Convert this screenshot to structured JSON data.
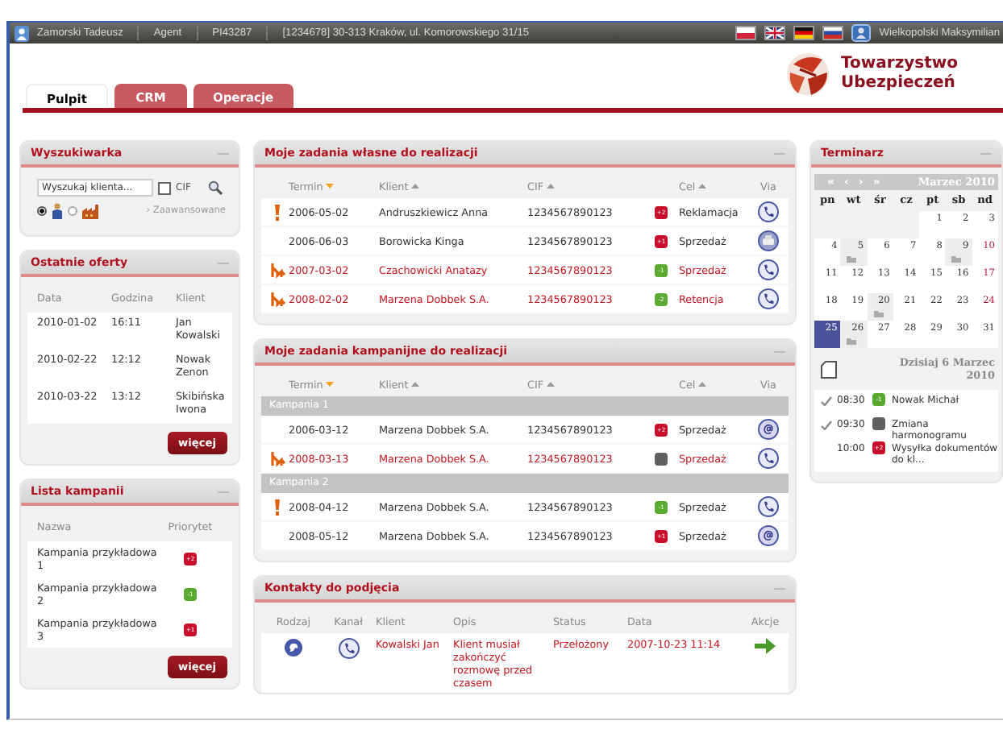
{
  "top_bar": {
    "user": "Zamorski Tadeusz",
    "role": "Agent",
    "agent_id": "PI43287",
    "address": "[1234678] 30-313 Kraków, ul. Komorowskiego 31/15",
    "languages": [
      {
        "kind": "pl"
      },
      {
        "kind": "gb"
      },
      {
        "kind": "de"
      },
      {
        "kind": "ru"
      }
    ],
    "contact": "Wielkopolski Maksymilian"
  },
  "tabs": [
    {
      "label": "Pulpit",
      "selected": true
    },
    {
      "label": "CRM",
      "selected": false
    },
    {
      "label": "Operacje",
      "selected": false
    }
  ],
  "logo": {
    "line1": "Towarzystwo",
    "line2": "Ubezpieczeń"
  },
  "search": {
    "title": "Wyszukiwarka",
    "placeholder": "Wyszukaj klienta...",
    "cif_label": "CIF",
    "cif_checked": false,
    "person_selected": true,
    "company_selected": false,
    "advanced_link": "› Zaawansowane"
  },
  "offers": {
    "title": "Ostatnie oferty",
    "columns": [
      "Data",
      "Godzina",
      "Klient"
    ],
    "rows": [
      [
        "2010-01-02",
        "16:11",
        "Jan Kowalski"
      ],
      [
        "2010-02-22",
        "12:12",
        "Nowak Zenon"
      ],
      [
        "2010-03-22",
        "13:12",
        "Skibińska Iwona"
      ]
    ],
    "button": "więcej"
  },
  "campaigns": {
    "title": "Lista kampanii",
    "columns": [
      "Nazwa",
      "Priorytet"
    ],
    "rows": [
      {
        "name": "Kampania przykładowa 1",
        "priority": "+2",
        "color": "#c8102e"
      },
      {
        "name": "Kampania przykładowa 2",
        "priority": "-1",
        "color": "#5aaa32"
      },
      {
        "name": "Kampania przykładowa 3",
        "priority": "+1",
        "color": "#c8102e"
      }
    ],
    "button": "więcej"
  },
  "own_tasks": {
    "title": "Moje zadania własne do realizacji",
    "columns": [
      {
        "label": "Termin",
        "sort": {
          "kind": "desc"
        }
      },
      {
        "label": "Klient",
        "sort": {
          "kind": "asc"
        }
      },
      {
        "label": "CIF",
        "sort": {
          "kind": "asc"
        }
      },
      {
        "label": "Cel",
        "sort": {
          "kind": "asc"
        }
      },
      {
        "label": "Via"
      }
    ],
    "rows": [
      {
        "alert": {
          "kind": "exclamation"
        },
        "date": "2006-05-02",
        "client": "Andruszkiewicz Anna",
        "cif": "1234567890123",
        "priority": "+2",
        "color": "#c8102e",
        "goal": "Reklamacja",
        "via": {
          "kind": "phone"
        },
        "highlighted": false
      },
      {
        "date": "2006-06-03",
        "client": "Borowicka Kinga",
        "cif": "1234567890123",
        "priority": "+1",
        "color": "#c8102e",
        "goal": "Sprzedaż",
        "via": {
          "kind": "fax"
        },
        "highlighted": false
      },
      {
        "alert": {
          "kind": "escalation"
        },
        "date": "2007-03-02",
        "client": "Czachowicki Anatazy",
        "cif": "1234567890123",
        "priority": "-1",
        "color": "#5aaa32",
        "goal": "Sprzedaż",
        "via": {
          "kind": "phone"
        },
        "highlighted": true
      },
      {
        "alert": {
          "kind": "escalation"
        },
        "date": "2008-02-02",
        "client": "Marzena Dobbek S.A.",
        "cif": "1234567890123",
        "priority": "-2",
        "color": "#5aaa32",
        "goal": "Retencja",
        "via": {
          "kind": "phone"
        },
        "highlighted": true
      }
    ]
  },
  "campaign_tasks": {
    "title": "Moje zadania kampanijne do realizacji",
    "columns": [
      {
        "label": "Termin",
        "sort": {
          "kind": "desc"
        }
      },
      {
        "label": "Klient",
        "sort": {
          "kind": "asc"
        }
      },
      {
        "label": "CIF",
        "sort": {
          "kind": "asc"
        }
      },
      {
        "label": "Cel",
        "sort": {
          "kind": "asc"
        }
      },
      {
        "label": "Via"
      }
    ],
    "groups": [
      {
        "name": "Kampania 1",
        "rows": [
          {
            "date": "2006-03-12",
            "client": "Marzena Dobbek S.A.",
            "cif": "1234567890123",
            "priority": "+2",
            "color": "#c8102e",
            "goal": "Sprzedaż",
            "via": {
              "kind": "email"
            },
            "highlighted": false
          },
          {
            "alert": {
              "kind": "escalation"
            },
            "date": "2008-03-13",
            "client": "Marzena Dobbek S.A.",
            "cif": "1234567890123",
            "color": "#606060",
            "goal": "Sprzedaż",
            "via": {
              "kind": "phone"
            },
            "highlighted": true
          }
        ]
      },
      {
        "name": "Kampania 2",
        "rows": [
          {
            "alert": {
              "kind": "exclamation"
            },
            "date": "2008-04-12",
            "client": "Marzena Dobbek S.A.",
            "cif": "1234567890123",
            "priority": "-1",
            "color": "#5aaa32",
            "goal": "Sprzedaż",
            "via": {
              "kind": "phone"
            },
            "highlighted": false
          },
          {
            "date": "2008-05-12",
            "client": "Marzena Dobbek S.A.",
            "cif": "1234567890123",
            "priority": "+1",
            "color": "#c8102e",
            "goal": "Sprzedaż",
            "via": {
              "kind": "email"
            },
            "highlighted": false
          }
        ]
      }
    ]
  },
  "contacts": {
    "title": "Kontakty do podjęcia",
    "columns": [
      "Rodzaj",
      "Kanał",
      "Klient",
      "Opis",
      "Status",
      "Data",
      "Akcje"
    ],
    "rows": [
      {
        "type": {
          "kind": "chat"
        },
        "channel": {
          "kind": "phone"
        },
        "client": "Kowalski Jan",
        "description": "Klient musiał zakończyć rozmowę przed czasem",
        "status": "Przełożony",
        "date": "2007-10-23 11:14"
      }
    ]
  },
  "calendar": {
    "title": "Terminarz",
    "nav": [
      "«",
      "‹",
      "›",
      "»"
    ],
    "month": "Marzec 2010",
    "weekdays": [
      "pn",
      "wt",
      "śr",
      "cz",
      "pt",
      "sb",
      "nd"
    ],
    "weeks": [
      [
        {
          "day": "1",
          "selected": false,
          "event": false,
          "red": false
        },
        {
          "day": "2",
          "selected": false,
          "event": false,
          "red": false
        },
        {
          "day": "3",
          "selected": false,
          "event": false,
          "red": false
        }
      ],
      [
        {
          "day": "4",
          "selected": false,
          "event": false,
          "red": false
        },
        {
          "day": "5",
          "selected": false,
          "event": true,
          "red": false
        },
        {
          "day": "6",
          "selected": false,
          "event": false,
          "red": false
        },
        {
          "day": "7",
          "selected": false,
          "event": false,
          "red": false
        },
        {
          "day": "8",
          "selected": false,
          "event": false,
          "red": false
        },
        {
          "day": "9",
          "selected": false,
          "event": true,
          "red": false
        },
        {
          "day": "10",
          "selected": false,
          "event": false,
          "red": true
        }
      ],
      [
        {
          "day": "11",
          "selected": false,
          "event": false,
          "red": false
        },
        {
          "day": "12",
          "selected": false,
          "event": false,
          "red": false
        },
        {
          "day": "13",
          "selected": false,
          "event": false,
          "red": false
        },
        {
          "day": "14",
          "selected": false,
          "event": false,
          "red": false
        },
        {
          "day": "15",
          "selected": false,
          "event": false,
          "red": false
        },
        {
          "day": "16",
          "selected": false,
          "event": false,
          "red": false
        },
        {
          "day": "17",
          "selected": false,
          "event": false,
          "red": true
        }
      ],
      [
        {
          "day": "18",
          "selected": false,
          "event": false,
          "red": false
        },
        {
          "day": "19",
          "selected": false,
          "event": false,
          "red": false
        },
        {
          "day": "20",
          "selected": false,
          "event": true,
          "red": false
        },
        {
          "day": "21",
          "selected": false,
          "event": false,
          "red": false
        },
        {
          "day": "22",
          "selected": false,
          "event": false,
          "red": false
        },
        {
          "day": "23",
          "selected": false,
          "event": false,
          "red": false
        },
        {
          "day": "24",
          "selected": false,
          "event": false,
          "red": true
        }
      ],
      [
        {
          "day": "25",
          "selected": true,
          "event": false,
          "red": false
        },
        {
          "day": "26",
          "selected": false,
          "event": true,
          "red": false
        },
        {
          "day": "27",
          "selected": false,
          "event": false,
          "red": false
        },
        {
          "day": "28",
          "selected": false,
          "event": false,
          "red": false
        },
        {
          "day": "29",
          "selected": false,
          "event": false,
          "red": false
        },
        {
          "day": "30",
          "selected": false,
          "event": false,
          "red": false
        },
        {
          "day": "31",
          "selected": false,
          "event": false,
          "red": false
        }
      ]
    ],
    "today_label": "Dzisiaj 6 Marzec 2010",
    "agenda": [
      {
        "done": true,
        "time": "08:30",
        "priority": "-1",
        "color": "#5aaa32",
        "text": "Nowak Michał"
      },
      {
        "done": true,
        "time": "09:30",
        "color": "#606060",
        "text": "Zmiana harmonogramu"
      },
      {
        "done": false,
        "time": "10:00",
        "priority": "+2",
        "color": "#c8102e",
        "text": "Wysyłka dokumentów do kl..."
      }
    ]
  }
}
